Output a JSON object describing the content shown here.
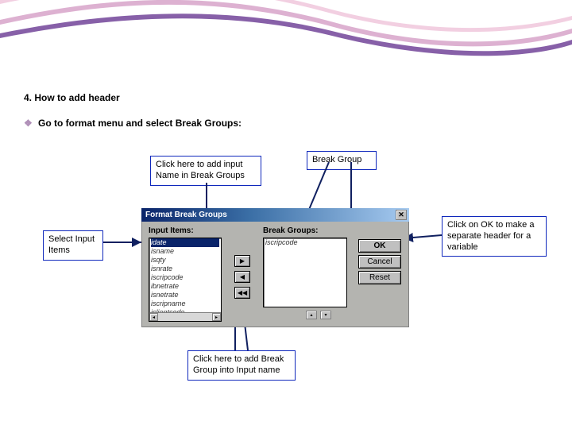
{
  "heading": "4. How to add header",
  "bullet_text": "Go to format menu and select Break Groups:",
  "callouts": {
    "select_input": "Select Input Items",
    "add_input": "Click here to add input Name in Break Groups",
    "break_group": "Break Group",
    "add_break": "Click here to add Break Group into Input name",
    "click_ok": "Click on OK to make a separate header for a variable"
  },
  "dialog": {
    "title": "Format Break Groups",
    "labels": {
      "input": "Input Items:",
      "break": "Break Groups:"
    },
    "input_items": [
      "idate",
      "isname",
      "isqty",
      "isnrate",
      "iscripcode",
      "ibnetrate",
      "isnetrate",
      "iscripname",
      "iclientcode"
    ],
    "break_items": [
      "iscripcode"
    ],
    "buttons": {
      "ok": "OK",
      "cancel": "Cancel",
      "reset": "Reset"
    },
    "transfer": {
      "right": "▶",
      "left": "◀",
      "dleft": "◀◀"
    }
  }
}
